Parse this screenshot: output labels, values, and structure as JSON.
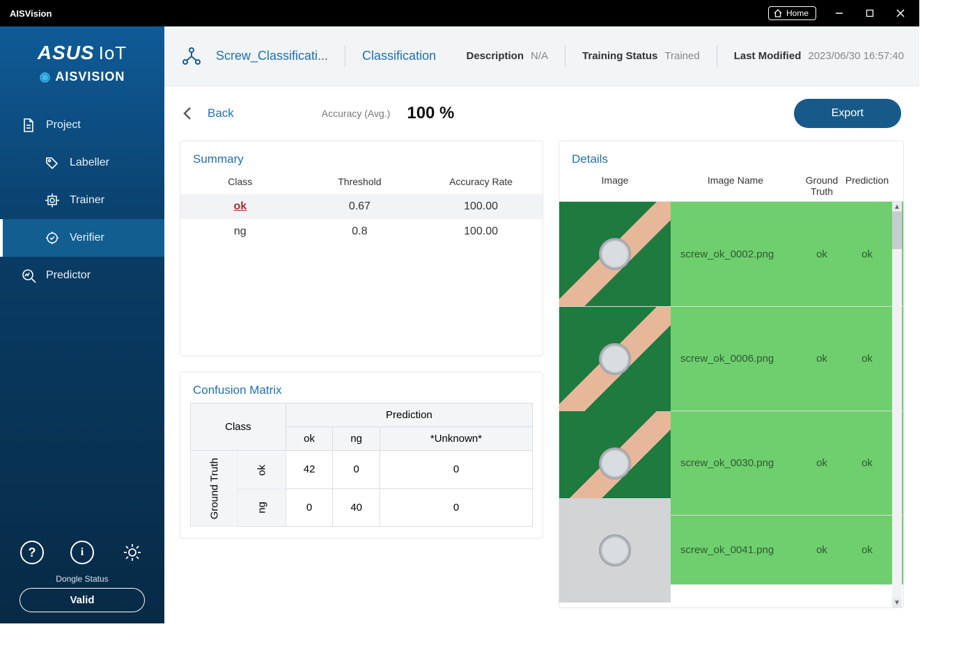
{
  "titlebar": {
    "app": "AISVision",
    "home": "Home"
  },
  "brand": {
    "line1a": "ASUS",
    "line1b": "IoT",
    "line2": "AISVISION"
  },
  "sidebar": {
    "project": "Project",
    "labeller": "Labeller",
    "trainer": "Trainer",
    "verifier": "Verifier",
    "predictor": "Predictor",
    "dongle_label": "Dongle Status",
    "dongle_value": "Valid"
  },
  "header": {
    "project_name": "Screw_Classificati...",
    "task_type": "Classification",
    "desc_label": "Description",
    "desc_value": "N/A",
    "train_label": "Training Status",
    "train_value": "Trained",
    "mod_label": "Last Modified",
    "mod_value": "2023/06/30 16:57:40"
  },
  "subhead": {
    "back": "Back",
    "acc_label": "Accuracy (Avg.)",
    "acc_value": "100 %",
    "export": "Export"
  },
  "summary": {
    "title": "Summary",
    "cols": {
      "class": "Class",
      "threshold": "Threshold",
      "acc": "Accuracy Rate"
    },
    "rows": [
      {
        "class": "ok",
        "threshold": "0.67",
        "acc": "100.00",
        "selected": true
      },
      {
        "class": "ng",
        "threshold": "0.8",
        "acc": "100.00",
        "selected": false
      }
    ]
  },
  "confusion": {
    "title": "Confusion Matrix",
    "class_label": "Class",
    "pred_label": "Prediction",
    "gt_label": "Ground Truth",
    "pred_cols": [
      "ok",
      "ng",
      "*Unknown*"
    ],
    "gt_rows": [
      "ok",
      "ng"
    ],
    "cells": [
      [
        "42",
        "0",
        "0"
      ],
      [
        "0",
        "40",
        "0"
      ]
    ]
  },
  "details": {
    "title": "Details",
    "cols": {
      "image": "Image",
      "name": "Image Name",
      "gt": "Ground Truth",
      "pred": "Prediction"
    },
    "rows": [
      {
        "name": "screw_ok_0002.png",
        "gt": "ok",
        "pred": "ok"
      },
      {
        "name": "screw_ok_0006.png",
        "gt": "ok",
        "pred": "ok"
      },
      {
        "name": "screw_ok_0030.png",
        "gt": "ok",
        "pred": "ok"
      },
      {
        "name": "screw_ok_0041.png",
        "gt": "ok",
        "pred": "ok"
      }
    ]
  }
}
